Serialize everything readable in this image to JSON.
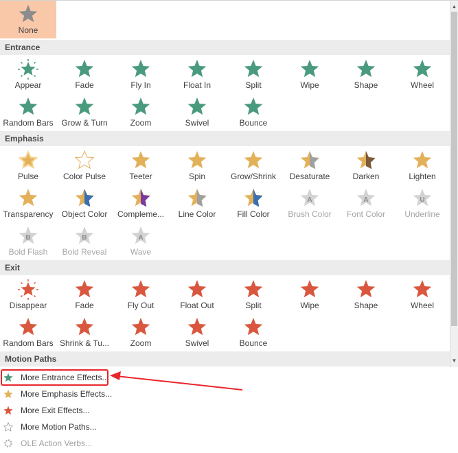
{
  "colors": {
    "entrance": "#4a9a7e",
    "emphasis": "#e2b15a",
    "exit": "#d9573e",
    "disabled": "#b8b8b8",
    "selected_bg": "#f8c8a8",
    "callout": "#e8262b"
  },
  "none_item": {
    "label": "None",
    "icon": "star-gray-icon"
  },
  "sections": [
    {
      "id": "entrance",
      "title": "Entrance",
      "items": [
        {
          "label": "Appear",
          "icon": "appear-icon"
        },
        {
          "label": "Fade",
          "icon": "fade-icon"
        },
        {
          "label": "Fly In",
          "icon": "fly-in-icon"
        },
        {
          "label": "Float In",
          "icon": "float-in-icon"
        },
        {
          "label": "Split",
          "icon": "split-icon"
        },
        {
          "label": "Wipe",
          "icon": "wipe-icon"
        },
        {
          "label": "Shape",
          "icon": "shape-icon"
        },
        {
          "label": "Wheel",
          "icon": "wheel-icon"
        },
        {
          "label": "Random Bars",
          "icon": "random-bars-icon"
        },
        {
          "label": "Grow & Turn",
          "icon": "grow-turn-icon"
        },
        {
          "label": "Zoom",
          "icon": "zoom-icon"
        },
        {
          "label": "Swivel",
          "icon": "swivel-icon"
        },
        {
          "label": "Bounce",
          "icon": "bounce-icon"
        }
      ]
    },
    {
      "id": "emphasis",
      "title": "Emphasis",
      "items": [
        {
          "label": "Pulse",
          "icon": "pulse-icon"
        },
        {
          "label": "Color Pulse",
          "icon": "color-pulse-icon"
        },
        {
          "label": "Teeter",
          "icon": "teeter-icon"
        },
        {
          "label": "Spin",
          "icon": "spin-icon"
        },
        {
          "label": "Grow/Shrink",
          "icon": "grow-shrink-icon"
        },
        {
          "label": "Desaturate",
          "icon": "desaturate-icon"
        },
        {
          "label": "Darken",
          "icon": "darken-icon"
        },
        {
          "label": "Lighten",
          "icon": "lighten-icon"
        },
        {
          "label": "Transparency",
          "icon": "transparency-icon"
        },
        {
          "label": "Object Color",
          "icon": "object-color-icon"
        },
        {
          "label": "Compleme...",
          "icon": "complementary-color-icon"
        },
        {
          "label": "Line Color",
          "icon": "line-color-icon"
        },
        {
          "label": "Fill Color",
          "icon": "fill-color-icon"
        },
        {
          "label": "Brush Color",
          "icon": "brush-color-icon",
          "disabled": true
        },
        {
          "label": "Font Color",
          "icon": "font-color-icon",
          "disabled": true
        },
        {
          "label": "Underline",
          "icon": "underline-icon",
          "disabled": true
        },
        {
          "label": "Bold Flash",
          "icon": "bold-flash-icon",
          "disabled": true
        },
        {
          "label": "Bold Reveal",
          "icon": "bold-reveal-icon",
          "disabled": true
        },
        {
          "label": "Wave",
          "icon": "wave-icon",
          "disabled": true
        }
      ]
    },
    {
      "id": "exit",
      "title": "Exit",
      "items": [
        {
          "label": "Disappear",
          "icon": "disappear-icon"
        },
        {
          "label": "Fade",
          "icon": "fade-icon"
        },
        {
          "label": "Fly Out",
          "icon": "fly-out-icon"
        },
        {
          "label": "Float Out",
          "icon": "float-out-icon"
        },
        {
          "label": "Split",
          "icon": "split-icon"
        },
        {
          "label": "Wipe",
          "icon": "wipe-icon"
        },
        {
          "label": "Shape",
          "icon": "shape-icon"
        },
        {
          "label": "Wheel",
          "icon": "wheel-icon"
        },
        {
          "label": "Random Bars",
          "icon": "random-bars-icon"
        },
        {
          "label": "Shrink & Tu...",
          "icon": "shrink-turn-icon"
        },
        {
          "label": "Zoom",
          "icon": "zoom-icon"
        },
        {
          "label": "Swivel",
          "icon": "swivel-icon"
        },
        {
          "label": "Bounce",
          "icon": "bounce-icon"
        }
      ]
    },
    {
      "id": "motion-paths",
      "title": "Motion Paths",
      "items": []
    }
  ],
  "menu": [
    {
      "label": "More Entrance Effects...",
      "icon": "star-green-icon",
      "highlighted": true
    },
    {
      "label": "More Emphasis Effects...",
      "icon": "star-gold-icon"
    },
    {
      "label": "More Exit Effects...",
      "icon": "star-red-icon"
    },
    {
      "label": "More Motion Paths...",
      "icon": "star-outline-icon"
    },
    {
      "label": "OLE Action Verbs...",
      "icon": "gear-icon",
      "disabled": true
    }
  ]
}
